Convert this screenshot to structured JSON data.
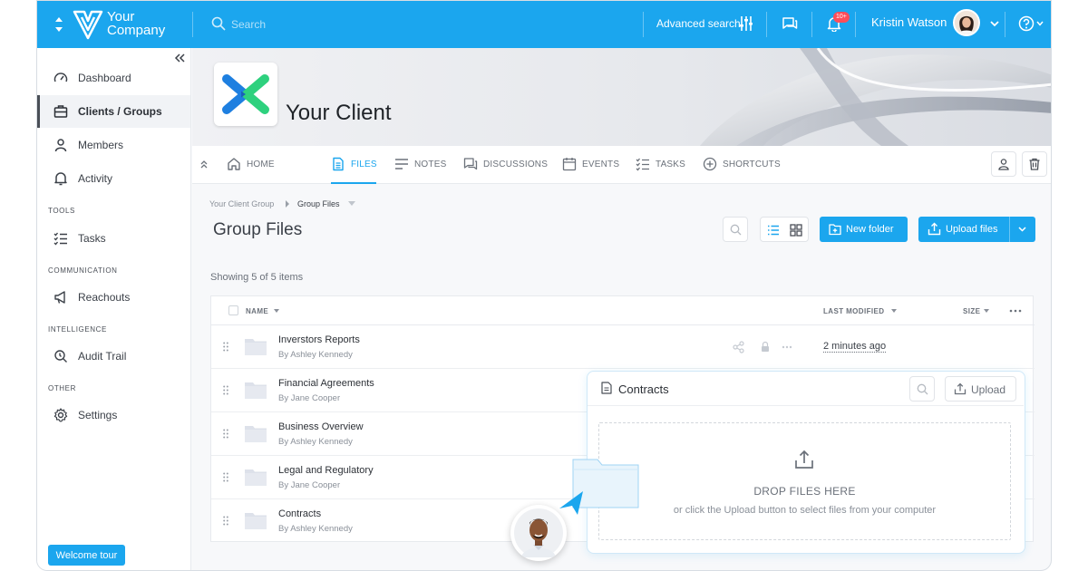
{
  "header": {
    "company_line1": "Your",
    "company_line2": "Company",
    "search_placeholder": "Search",
    "advanced_search": "Advanced search",
    "notification_badge": "10+",
    "user_name": "Kristin Watson"
  },
  "sidebar": {
    "items": [
      {
        "label": "Dashboard",
        "icon": "gauge-icon"
      },
      {
        "label": "Clients / Groups",
        "icon": "briefcase-icon",
        "active": true
      },
      {
        "label": "Members",
        "icon": "user-icon"
      },
      {
        "label": "Activity",
        "icon": "bell-icon"
      }
    ],
    "sections": [
      {
        "title": "TOOLS",
        "items": [
          {
            "label": "Tasks",
            "icon": "tasks-icon"
          }
        ]
      },
      {
        "title": "COMMUNICATION",
        "items": [
          {
            "label": "Reachouts",
            "icon": "megaphone-icon"
          }
        ]
      },
      {
        "title": "INTELLIGENCE",
        "items": [
          {
            "label": "Audit Trail",
            "icon": "audit-icon"
          }
        ]
      },
      {
        "title": "OTHER",
        "items": [
          {
            "label": "Settings",
            "icon": "gear-icon"
          }
        ]
      }
    ],
    "welcome_tour": "Welcome tour"
  },
  "banner": {
    "client_name": "Your Client"
  },
  "tabs": [
    {
      "label": "HOME",
      "icon": "home-icon"
    },
    {
      "label": "FILES",
      "icon": "file-icon",
      "active": true
    },
    {
      "label": "NOTES",
      "icon": "notes-icon"
    },
    {
      "label": "DISCUSSIONS",
      "icon": "discussions-icon"
    },
    {
      "label": "EVENTS",
      "icon": "calendar-icon"
    },
    {
      "label": "TASKS",
      "icon": "tasks-icon"
    },
    {
      "label": "SHORTCUTS",
      "icon": "plus-circle-icon"
    }
  ],
  "breadcrumb": {
    "parent": "Your Client Group",
    "current": "Group Files"
  },
  "page": {
    "title": "Group Files",
    "new_folder": "New folder",
    "upload_files": "Upload files",
    "showing": "Showing 5 of 5 items"
  },
  "table": {
    "columns": {
      "name": "NAME",
      "last_modified": "LAST MODIFIED",
      "size": "SIZE"
    },
    "rows": [
      {
        "name": "Inverstors Reports",
        "by": "By Ashley Kennedy",
        "modified": "2 minutes ago"
      },
      {
        "name": "Financial Agreements",
        "by": "By Jane Cooper",
        "modified": ""
      },
      {
        "name": "Business Overview",
        "by": "By Ashley Kennedy",
        "modified": ""
      },
      {
        "name": "Legal and Regulatory",
        "by": "By Jane Cooper",
        "modified": ""
      },
      {
        "name": "Contracts",
        "by": "By Ashley Kennedy",
        "modified": ""
      }
    ]
  },
  "upload_panel": {
    "title": "Contracts",
    "upload_button": "Upload",
    "drop_title": "DROP FILES HERE",
    "drop_subtitle": "or click the Upload button to select files from your computer"
  },
  "colors": {
    "accent": "#1ba6ee",
    "badge": "#ff4d5a",
    "logo_blue": "#1e7fe0",
    "logo_green": "#2ed17e"
  }
}
